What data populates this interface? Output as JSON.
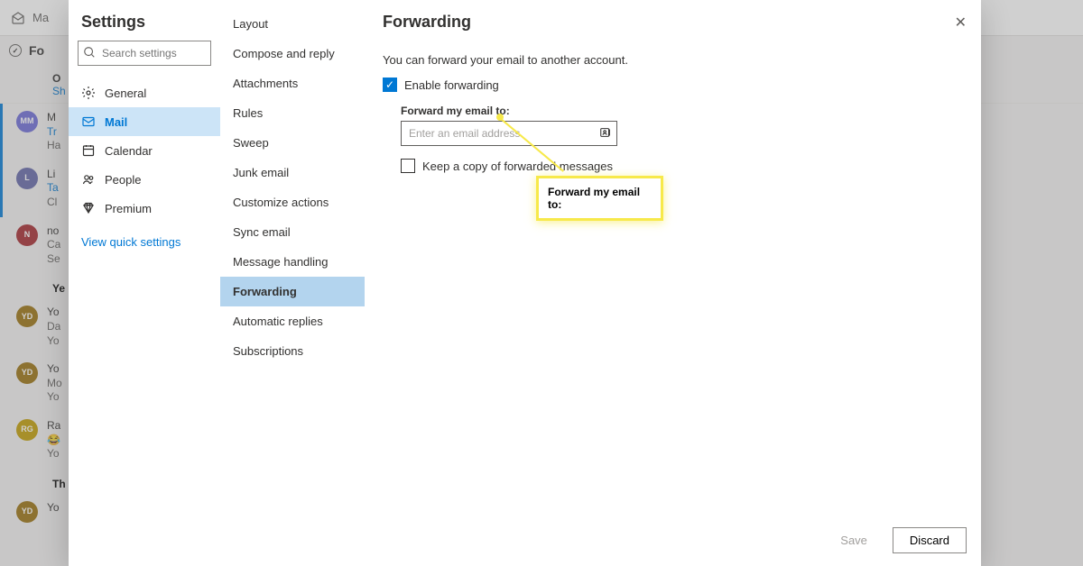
{
  "bg_top": {
    "label": "Ma"
  },
  "bg_folder": "Fo",
  "bg_other": {
    "header": "O",
    "show": "Sh"
  },
  "messages": [
    {
      "bar": true,
      "color": "#6b69d6",
      "initials": "MM",
      "l1": "M",
      "l2": "Tr",
      "l3": "Ha",
      "c2": "#0078d4"
    },
    {
      "bar": true,
      "color": "#6264a7",
      "initials": "L",
      "l1": "Li",
      "l2": "Ta",
      "l3": "Cl",
      "c2": "#0078d4"
    },
    {
      "bar": false,
      "color": "#a4262c",
      "initials": "N",
      "l1": "no",
      "l2": "Ca",
      "l3": "Se"
    },
    {
      "header": "Ye"
    },
    {
      "bar": false,
      "color": "#986f0b",
      "initials": "YD",
      "l1": "Yo",
      "l2": "Da",
      "l3": "Yo"
    },
    {
      "bar": false,
      "color": "#986f0b",
      "initials": "YD",
      "l1": "Yo",
      "l2": "Mo",
      "l3": "Yo"
    },
    {
      "bar": false,
      "color": "#c19c00",
      "initials": "RG",
      "l1": "Ra",
      "l2": "😂",
      "l3": "Yo"
    },
    {
      "header": "Th"
    },
    {
      "bar": false,
      "color": "#986f0b",
      "initials": "YD",
      "l1": "Yo",
      "l2": "",
      "l3": ""
    }
  ],
  "settings": {
    "title": "Settings",
    "search_placeholder": "Search settings",
    "nav": [
      {
        "icon": "gear",
        "label": "General"
      },
      {
        "icon": "mail",
        "label": "Mail",
        "active": true
      },
      {
        "icon": "calendar",
        "label": "Calendar"
      },
      {
        "icon": "people",
        "label": "People"
      },
      {
        "icon": "diamond",
        "label": "Premium"
      }
    ],
    "quick": "View quick settings"
  },
  "subnav": [
    "Layout",
    "Compose and reply",
    "Attachments",
    "Rules",
    "Sweep",
    "Junk email",
    "Customize actions",
    "Sync email",
    "Message handling",
    "Forwarding",
    "Automatic replies",
    "Subscriptions"
  ],
  "subnav_active": 9,
  "pane": {
    "title": "Forwarding",
    "desc": "You can forward your email to another account.",
    "enable": "Enable forwarding",
    "fwd_label": "Forward my email to:",
    "placeholder": "Enter an email address",
    "keep_copy": "Keep a copy of forwarded messages",
    "save": "Save",
    "discard": "Discard"
  },
  "callout": "Forward my email to:"
}
